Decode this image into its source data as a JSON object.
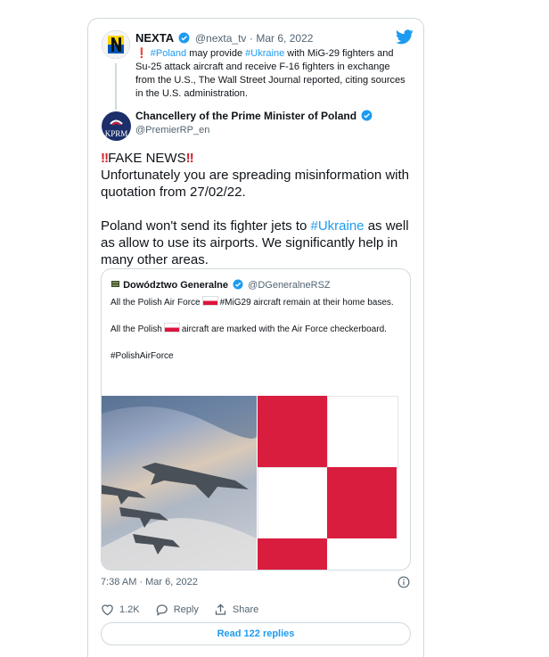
{
  "parent_tweet": {
    "name": "NEXTA",
    "handle": "@nexta_tv",
    "date": "· Mar 6, 2022",
    "text_pre": "",
    "hashtag_poland": "#Poland",
    "text_1": " may provide ",
    "hashtag_ukraine": "#Ukraine",
    "text_2": " with MiG-29 fighters and Su-25 attack aircraft and receive F-16 fighters in exchange from the U.S., The Wall Street Journal reported, citing sources in the U.S. administration."
  },
  "main_tweet": {
    "name": "Chancellery of the Prime Minister of Poland",
    "handle": "@PremierRP_en",
    "avatar_text": "KPRM",
    "fake_news": "FAKE NEWS",
    "line_1": "Unfortunately you are spreading misinformation with quotation from 27/02/22.",
    "line_2_pre": "Poland won't send its fighter jets to ",
    "line_2_hashtag": "#Ukraine",
    "line_2_post": " as well as allow to use its airports. We significantly help in many other areas."
  },
  "quote": {
    "name": "Dowództwo Generalne",
    "handle": "@DGeneralneRSZ",
    "p1_pre": "All the Polish Air Force",
    "p1_post": "#MiG29 aircraft remain at their home bases.",
    "p2_pre": "All the Polish",
    "p2_post": "aircraft are marked with the Air Force checkerboard.",
    "p3": "#PolishAirForce"
  },
  "footer": {
    "timestamp": "7:38 AM · Mar 6, 2022",
    "like_count": "1.2K",
    "reply_label": "Reply",
    "share_label": "Share",
    "read_replies": "Read 122 replies"
  },
  "icons": {
    "bird": "twitter-bird-icon",
    "verified": "verified-badge-icon",
    "info": "info-icon",
    "heart": "heart-icon",
    "reply": "reply-icon",
    "share": "share-icon"
  },
  "colors": {
    "accent": "#1d9bf0",
    "poland_red": "#d91d3e",
    "text": "#0f1419",
    "muted": "#536471"
  }
}
